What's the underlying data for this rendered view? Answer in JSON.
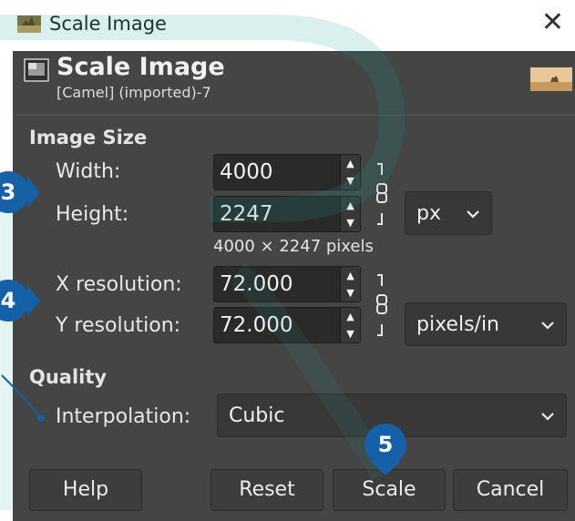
{
  "window": {
    "title": "Scale Image",
    "close_glyph": "✕"
  },
  "header": {
    "title": "Scale Image",
    "subtitle": "[Camel] (imported)-7",
    "icon": "scale-image-icon",
    "thumbnail": "camel-thumbnail"
  },
  "image_size": {
    "section_label": "Image Size",
    "width_label": "Width:",
    "width_value": "4000",
    "height_label": "Height:",
    "height_value": "2247",
    "unit": "px",
    "pixel_info": "4000 × 2247 pixels",
    "x_res_label": "X resolution:",
    "x_res_value": "72.000",
    "y_res_label": "Y resolution:",
    "y_res_value": "72.000",
    "res_unit": "pixels/in"
  },
  "quality": {
    "section_label": "Quality",
    "interpolation_label": "Interpolation:",
    "interpolation_value": "Cubic"
  },
  "buttons": {
    "help": "Help",
    "reset": "Reset",
    "scale": "Scale",
    "cancel": "Cancel"
  },
  "callouts": [
    "3",
    "4",
    "5"
  ],
  "colors": {
    "dialog_bg": "#454545",
    "entry_bg": "#2a2a2a",
    "callout": "#1560a6"
  }
}
